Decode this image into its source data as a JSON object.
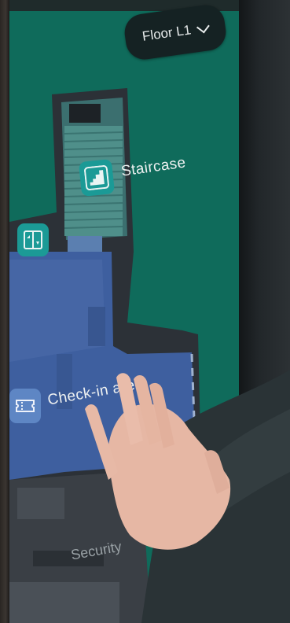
{
  "floor_selector": {
    "label": "Floor L1",
    "icon": "chevron-down-icon"
  },
  "pois": {
    "staircase": {
      "label": "Staircase",
      "icon": "staircase-icon"
    },
    "checkin": {
      "label": "Check-in area",
      "icon": "ticket-icon"
    },
    "elevator": {
      "icon": "elevator-icon"
    },
    "security": {
      "label": "Security"
    }
  },
  "colors": {
    "map_background": "#0f6b5b",
    "corridor": "#2b3036",
    "checkin_area": "#3d5f9e",
    "staircase": "#4b8a85",
    "security_area": "#3a3f45",
    "icon_teal": "#1b9a96"
  }
}
